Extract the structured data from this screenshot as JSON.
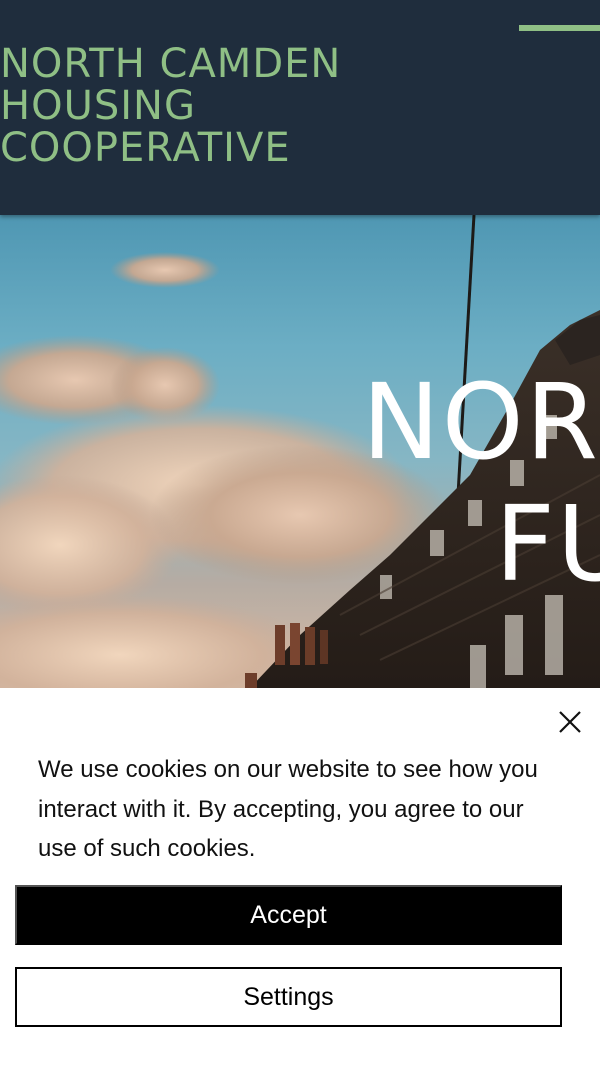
{
  "header": {
    "brand_lines": [
      "NORTH CAMDEN",
      "HOUSING",
      "COOPERATIVE"
    ],
    "menu_icon": "hamburger-bar-icon",
    "brand_color": "#8fbf85",
    "background_color": "#1f2d3d"
  },
  "hero": {
    "title_line1": "NOR",
    "title_line2": "FU",
    "background": "sky-clouds-rooftops-photo"
  },
  "cookie_banner": {
    "message": "We use cookies on our website to see how you interact with it. By accepting, you agree to our use of such cookies.",
    "accept_label": "Accept",
    "settings_label": "Settings",
    "close_icon": "close-icon"
  }
}
